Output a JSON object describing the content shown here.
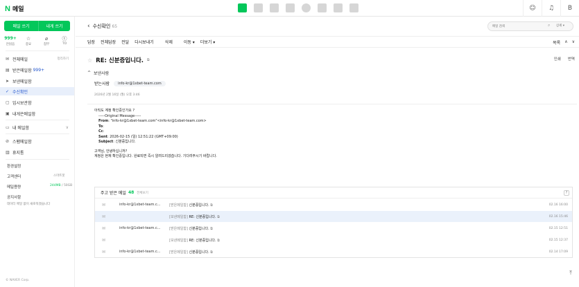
{
  "app": {
    "logo_n": "N",
    "logo_text": "메일"
  },
  "topbar_right": {
    "talk": "☺",
    "bell": "♫",
    "user": "B"
  },
  "sidebar": {
    "write_label": "메일 쓰기",
    "self_label": "내게 쓰기",
    "quick": [
      {
        "top": "999+",
        "label": "안읽음"
      },
      {
        "top": "☆",
        "label": "중요"
      },
      {
        "top": "⌀",
        "label": "첨부"
      },
      {
        "top": "ⓣ",
        "label": "TO"
      }
    ],
    "menu": {
      "all": "전체메일",
      "all_right": "정리하기",
      "inbox": "받은메일함",
      "inbox_count": "999+",
      "sent": "보낸메일함",
      "confirm": "수신확인",
      "draft": "임시보관함",
      "self": "내게쓴메일함",
      "mybox": "내 메일함",
      "spam": "스팸메일함",
      "trash": "휴지통",
      "settings": "환경설정",
      "support": "고객센터",
      "support_right": "스마트봇",
      "storage": "메일용량",
      "storage_used": "244MB",
      "storage_total": "/ 50GB",
      "notice": "공지사항",
      "notice_text": "데이터 메일 없이 새로워졌습니다"
    },
    "copyright": "© NAVER Corp."
  },
  "header": {
    "title": "수신확인",
    "count": "65",
    "search_placeholder": "메일 검색",
    "search_detail": "상세 ▾"
  },
  "toolbar": {
    "reply": "답장",
    "reply_all": "전체답장",
    "forward": "전달",
    "resend": "다시보내기",
    "delete": "삭제",
    "move": "이동 ▾",
    "more": "더보기 ▾",
    "list": "목록",
    "up": "∧",
    "down": "∨"
  },
  "mail": {
    "subject": "RE: 신분증입니다.",
    "print": "인쇄",
    "translate": "번역",
    "sender": "보낸사람",
    "recipient_label": "받는사람",
    "recipient": "info-kr@1xbet-team.com",
    "date": "2026년 2월 16일 (월) 오후 3:46",
    "body": {
      "l1": "아직도 계정 확인중인가요 ?",
      "l2": "-----Original Message-----",
      "from_label": "From",
      "from_val": ": \"info-kr@1xbet-team.com\"<info-kr@1xbet-team.com>",
      "to_label": "To",
      "to_val": ":",
      "cc_label": "Cc",
      "cc_val": ":",
      "sent_label": "Sent",
      "sent_val": ": 2026-02-15 (일) 12:51:22 (GMT+09:00)",
      "subject_label": "Subject",
      "subject_val": ": 신분증입니다.",
      "l3": "고객님, 안녕하십니까?",
      "l4": "계정은 현재 확인중입니다. 완료되면 즉시 알려드리겠습니다. 기다려주시기 바랍니다."
    }
  },
  "recent": {
    "title": "주고 받은 메일",
    "count": "48",
    "all": "전체보기",
    "help": "?",
    "rows": [
      {
        "from": "info-kr@1xbet-team.c...",
        "tag": "[받은메일함]",
        "subject": "신분증입니다.",
        "date": "02.16 16:00"
      },
      {
        "from": "",
        "tag": "[보낸메일함]",
        "subject": "RE: 신분증입니다.",
        "date": "02.16 15:46"
      },
      {
        "from": "info-kr@1xbet-team.c...",
        "tag": "[받은메일함]",
        "subject": "신분증입니다.",
        "date": "02.15 12:51"
      },
      {
        "from": "",
        "tag": "[보낸메일함]",
        "subject": "RE: 신분증입니다.",
        "date": "02.15 12:37"
      },
      {
        "from": "info-kr@1xbet-team.c...",
        "tag": "[받은메일함]",
        "subject": "신분증입니다.",
        "date": "02.14 17:09"
      }
    ]
  },
  "icons": {
    "back": "‹",
    "search": "⌕",
    "external": "⧉",
    "envelope": "✉",
    "top": "⤒",
    "collapse": "^",
    "chevron": "∨"
  }
}
